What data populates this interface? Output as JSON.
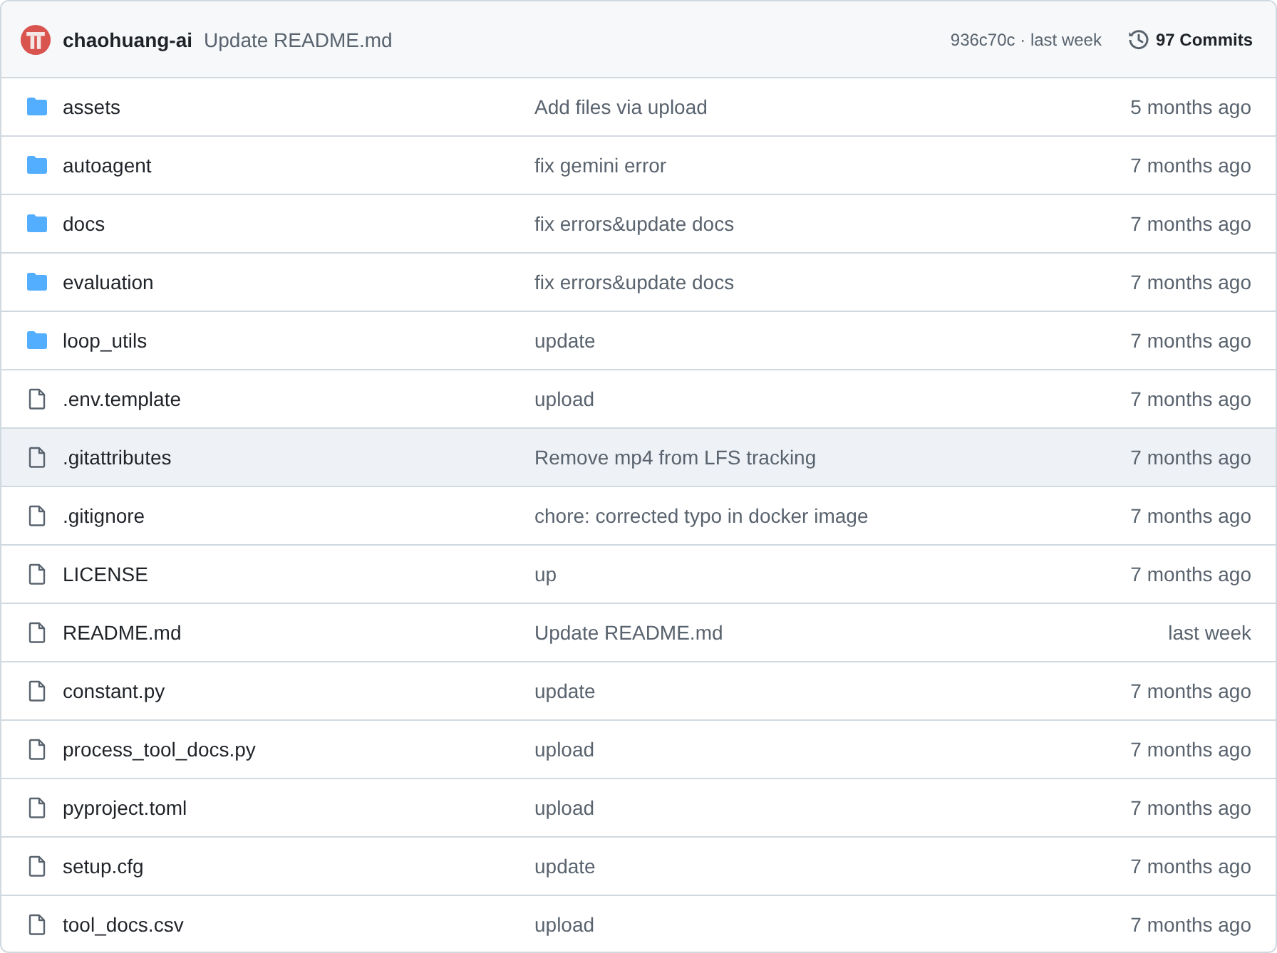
{
  "commit_bar": {
    "author": "chaohuang-ai",
    "message": "Update README.md",
    "sha_time": "936c70c · last week",
    "commits": "97 Commits"
  },
  "files": [
    {
      "kind": "folder",
      "name": "assets",
      "message": "Add files via upload",
      "time": "5 months ago",
      "selected": false
    },
    {
      "kind": "folder",
      "name": "autoagent",
      "message": "fix gemini error",
      "time": "7 months ago",
      "selected": false
    },
    {
      "kind": "folder",
      "name": "docs",
      "message": "fix errors&update docs",
      "time": "7 months ago",
      "selected": false
    },
    {
      "kind": "folder",
      "name": "evaluation",
      "message": "fix errors&update docs",
      "time": "7 months ago",
      "selected": false
    },
    {
      "kind": "folder",
      "name": "loop_utils",
      "message": "update",
      "time": "7 months ago",
      "selected": false
    },
    {
      "kind": "file",
      "name": ".env.template",
      "message": "upload",
      "time": "7 months ago",
      "selected": false
    },
    {
      "kind": "file",
      "name": ".gitattributes",
      "message": "Remove mp4 from LFS tracking",
      "time": "7 months ago",
      "selected": true
    },
    {
      "kind": "file",
      "name": ".gitignore",
      "message": "chore: corrected typo in docker image",
      "time": "7 months ago",
      "selected": false
    },
    {
      "kind": "file",
      "name": "LICENSE",
      "message": "up",
      "time": "7 months ago",
      "selected": false
    },
    {
      "kind": "file",
      "name": "README.md",
      "message": "Update README.md",
      "time": "last week",
      "selected": false
    },
    {
      "kind": "file",
      "name": "constant.py",
      "message": "update",
      "time": "7 months ago",
      "selected": false
    },
    {
      "kind": "file",
      "name": "process_tool_docs.py",
      "message": "upload",
      "time": "7 months ago",
      "selected": false
    },
    {
      "kind": "file",
      "name": "pyproject.toml",
      "message": "upload",
      "time": "7 months ago",
      "selected": false
    },
    {
      "kind": "file",
      "name": "setup.cfg",
      "message": "update",
      "time": "7 months ago",
      "selected": false
    },
    {
      "kind": "file",
      "name": "tool_docs.csv",
      "message": "upload",
      "time": "7 months ago",
      "selected": false
    }
  ]
}
